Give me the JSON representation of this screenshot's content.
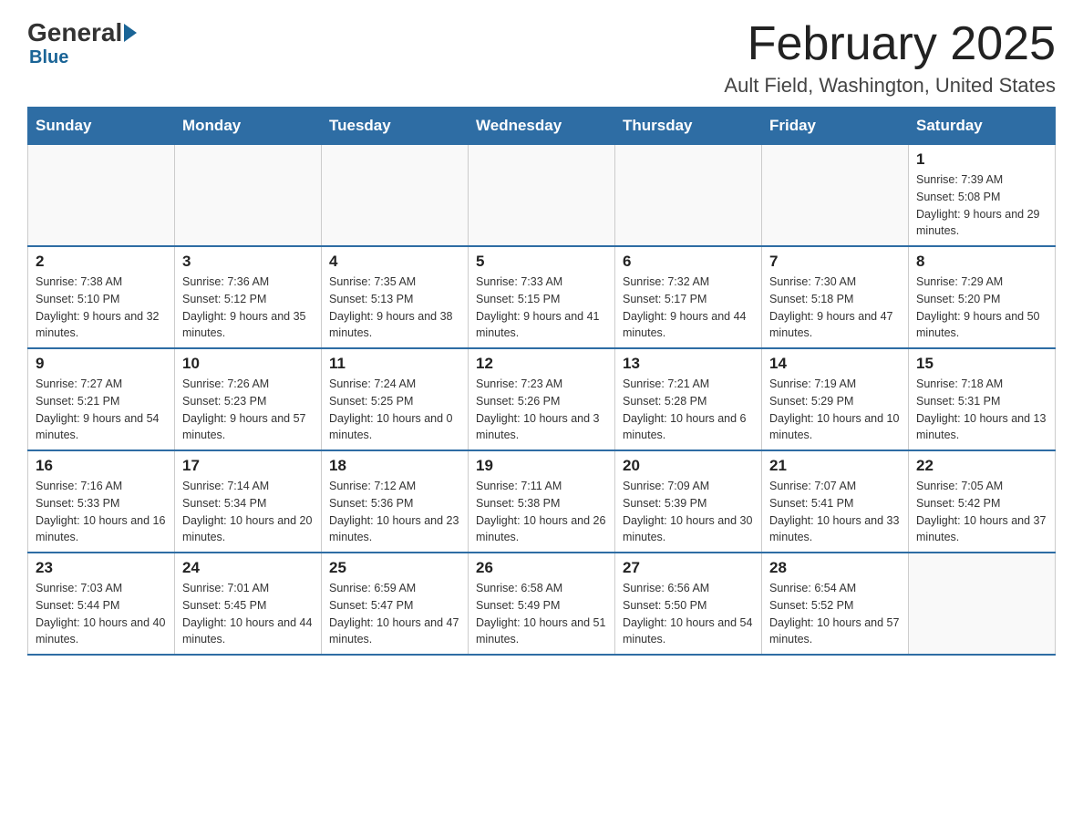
{
  "header": {
    "logo_general": "General",
    "logo_blue": "Blue",
    "title": "February 2025",
    "subtitle": "Ault Field, Washington, United States"
  },
  "days_of_week": [
    "Sunday",
    "Monday",
    "Tuesday",
    "Wednesday",
    "Thursday",
    "Friday",
    "Saturday"
  ],
  "weeks": [
    {
      "days": [
        {
          "num": "",
          "info": ""
        },
        {
          "num": "",
          "info": ""
        },
        {
          "num": "",
          "info": ""
        },
        {
          "num": "",
          "info": ""
        },
        {
          "num": "",
          "info": ""
        },
        {
          "num": "",
          "info": ""
        },
        {
          "num": "1",
          "info": "Sunrise: 7:39 AM\nSunset: 5:08 PM\nDaylight: 9 hours and 29 minutes."
        }
      ]
    },
    {
      "days": [
        {
          "num": "2",
          "info": "Sunrise: 7:38 AM\nSunset: 5:10 PM\nDaylight: 9 hours and 32 minutes."
        },
        {
          "num": "3",
          "info": "Sunrise: 7:36 AM\nSunset: 5:12 PM\nDaylight: 9 hours and 35 minutes."
        },
        {
          "num": "4",
          "info": "Sunrise: 7:35 AM\nSunset: 5:13 PM\nDaylight: 9 hours and 38 minutes."
        },
        {
          "num": "5",
          "info": "Sunrise: 7:33 AM\nSunset: 5:15 PM\nDaylight: 9 hours and 41 minutes."
        },
        {
          "num": "6",
          "info": "Sunrise: 7:32 AM\nSunset: 5:17 PM\nDaylight: 9 hours and 44 minutes."
        },
        {
          "num": "7",
          "info": "Sunrise: 7:30 AM\nSunset: 5:18 PM\nDaylight: 9 hours and 47 minutes."
        },
        {
          "num": "8",
          "info": "Sunrise: 7:29 AM\nSunset: 5:20 PM\nDaylight: 9 hours and 50 minutes."
        }
      ]
    },
    {
      "days": [
        {
          "num": "9",
          "info": "Sunrise: 7:27 AM\nSunset: 5:21 PM\nDaylight: 9 hours and 54 minutes."
        },
        {
          "num": "10",
          "info": "Sunrise: 7:26 AM\nSunset: 5:23 PM\nDaylight: 9 hours and 57 minutes."
        },
        {
          "num": "11",
          "info": "Sunrise: 7:24 AM\nSunset: 5:25 PM\nDaylight: 10 hours and 0 minutes."
        },
        {
          "num": "12",
          "info": "Sunrise: 7:23 AM\nSunset: 5:26 PM\nDaylight: 10 hours and 3 minutes."
        },
        {
          "num": "13",
          "info": "Sunrise: 7:21 AM\nSunset: 5:28 PM\nDaylight: 10 hours and 6 minutes."
        },
        {
          "num": "14",
          "info": "Sunrise: 7:19 AM\nSunset: 5:29 PM\nDaylight: 10 hours and 10 minutes."
        },
        {
          "num": "15",
          "info": "Sunrise: 7:18 AM\nSunset: 5:31 PM\nDaylight: 10 hours and 13 minutes."
        }
      ]
    },
    {
      "days": [
        {
          "num": "16",
          "info": "Sunrise: 7:16 AM\nSunset: 5:33 PM\nDaylight: 10 hours and 16 minutes."
        },
        {
          "num": "17",
          "info": "Sunrise: 7:14 AM\nSunset: 5:34 PM\nDaylight: 10 hours and 20 minutes."
        },
        {
          "num": "18",
          "info": "Sunrise: 7:12 AM\nSunset: 5:36 PM\nDaylight: 10 hours and 23 minutes."
        },
        {
          "num": "19",
          "info": "Sunrise: 7:11 AM\nSunset: 5:38 PM\nDaylight: 10 hours and 26 minutes."
        },
        {
          "num": "20",
          "info": "Sunrise: 7:09 AM\nSunset: 5:39 PM\nDaylight: 10 hours and 30 minutes."
        },
        {
          "num": "21",
          "info": "Sunrise: 7:07 AM\nSunset: 5:41 PM\nDaylight: 10 hours and 33 minutes."
        },
        {
          "num": "22",
          "info": "Sunrise: 7:05 AM\nSunset: 5:42 PM\nDaylight: 10 hours and 37 minutes."
        }
      ]
    },
    {
      "days": [
        {
          "num": "23",
          "info": "Sunrise: 7:03 AM\nSunset: 5:44 PM\nDaylight: 10 hours and 40 minutes."
        },
        {
          "num": "24",
          "info": "Sunrise: 7:01 AM\nSunset: 5:45 PM\nDaylight: 10 hours and 44 minutes."
        },
        {
          "num": "25",
          "info": "Sunrise: 6:59 AM\nSunset: 5:47 PM\nDaylight: 10 hours and 47 minutes."
        },
        {
          "num": "26",
          "info": "Sunrise: 6:58 AM\nSunset: 5:49 PM\nDaylight: 10 hours and 51 minutes."
        },
        {
          "num": "27",
          "info": "Sunrise: 6:56 AM\nSunset: 5:50 PM\nDaylight: 10 hours and 54 minutes."
        },
        {
          "num": "28",
          "info": "Sunrise: 6:54 AM\nSunset: 5:52 PM\nDaylight: 10 hours and 57 minutes."
        },
        {
          "num": "",
          "info": ""
        }
      ]
    }
  ]
}
